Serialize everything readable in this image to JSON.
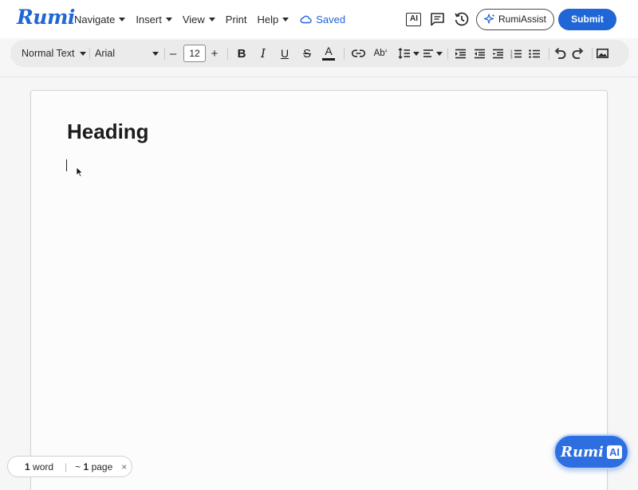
{
  "app": {
    "logo": "Rumi",
    "saved_status": "Saved"
  },
  "menu": [
    {
      "label": "Navigate",
      "has_caret": true
    },
    {
      "label": "Insert",
      "has_caret": true
    },
    {
      "label": "View",
      "has_caret": true
    },
    {
      "label": "Print",
      "has_caret": false
    },
    {
      "label": "Help",
      "has_caret": true
    }
  ],
  "header_actions": {
    "ai_icon_label": "AI",
    "assist_label": "RumiAssist",
    "submit_label": "Submit"
  },
  "toolbar": {
    "style_select": "Normal Text",
    "font_select": "Arial",
    "font_size": "12",
    "decrease_label": "–",
    "increase_label": "+",
    "bold": "B",
    "italic": "I",
    "underline": "U",
    "strike": "S",
    "text_color": "A",
    "spellcheck": "Ab"
  },
  "document": {
    "heading": "Heading"
  },
  "status": {
    "word_count": "1",
    "word_label": "word",
    "page_prefix": "~",
    "page_count": "1",
    "page_label": "page",
    "close": "×"
  },
  "rumi_ai": {
    "logo": "Rumi",
    "badge": "AI"
  },
  "colors": {
    "accent": "#2166d6",
    "toolbar_bg": "#ebebec",
    "page_bg": "#fcfcfd"
  }
}
